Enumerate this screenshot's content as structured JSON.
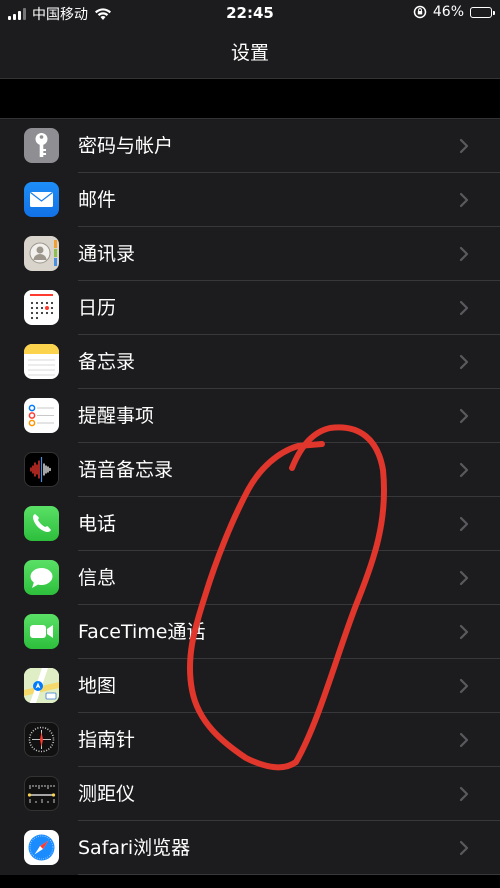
{
  "status": {
    "carrier": "中国移动",
    "time": "22:45",
    "battery": "46%",
    "battery_level": 0.46
  },
  "nav": {
    "title": "设置"
  },
  "items": [
    {
      "label": "密码与帐户",
      "icon": "key-icon"
    },
    {
      "label": "邮件",
      "icon": "mail-icon"
    },
    {
      "label": "通讯录",
      "icon": "contacts-icon"
    },
    {
      "label": "日历",
      "icon": "calendar-icon"
    },
    {
      "label": "备忘录",
      "icon": "notes-icon"
    },
    {
      "label": "提醒事项",
      "icon": "reminders-icon"
    },
    {
      "label": "语音备忘录",
      "icon": "voice-memos-icon"
    },
    {
      "label": "电话",
      "icon": "phone-icon"
    },
    {
      "label": "信息",
      "icon": "messages-icon"
    },
    {
      "label": "FaceTime通话",
      "icon": "facetime-icon"
    },
    {
      "label": "地图",
      "icon": "maps-icon"
    },
    {
      "label": "指南针",
      "icon": "compass-icon"
    },
    {
      "label": "测距仪",
      "icon": "measure-icon"
    },
    {
      "label": "Safari浏览器",
      "icon": "safari-icon"
    }
  ],
  "colors": {
    "background": "#000000",
    "row_background": "#1c1c1e",
    "separator": "#38383a",
    "annotation": "#e0362c"
  }
}
